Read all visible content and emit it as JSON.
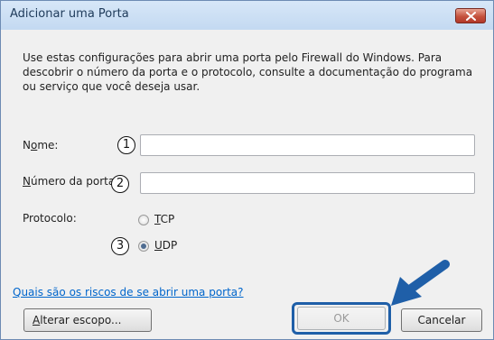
{
  "dialog": {
    "title": "Adicionar uma Porta",
    "description": "Use estas configurações para abrir uma porta pelo Firewall do Windows. Para descobrir o número da porta e o protocolo, consulte a documentação do programa ou serviço que você deseja usar."
  },
  "fields": {
    "name_label": "Nome:",
    "name_value": "",
    "port_label": "Número da porta:",
    "port_value": ""
  },
  "protocol": {
    "label": "Protocolo:",
    "options": [
      {
        "label": "TCP",
        "selected": false
      },
      {
        "label": "UDP",
        "selected": true
      }
    ]
  },
  "markers": [
    "1",
    "2",
    "3"
  ],
  "link": "Quais são os riscos de se abrir uma porta?",
  "buttons": {
    "change_scope": "Alterar escopo...",
    "ok": "OK",
    "cancel": "Cancelar"
  },
  "colors": {
    "link": "#0066cc",
    "highlight": "#1f5fa8",
    "close": "#c5523e"
  },
  "icons": [
    "close-icon",
    "arrow-pointer-icon"
  ]
}
